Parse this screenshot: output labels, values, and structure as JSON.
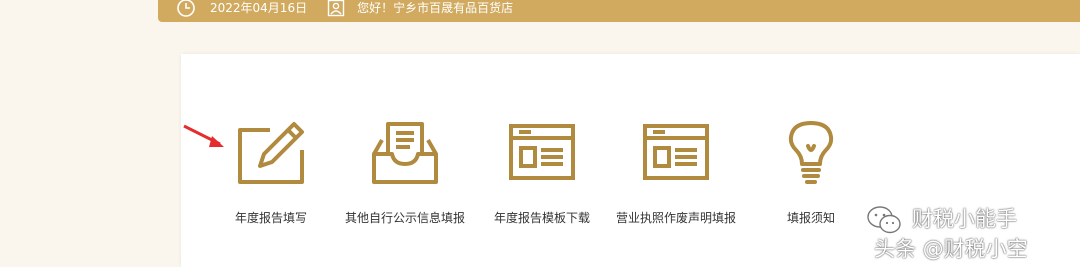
{
  "colors": {
    "accent": "#d1aa5f",
    "icon": "#b08a3e",
    "arrow": "#e52d2d"
  },
  "header": {
    "date": "2022年04月16日",
    "greeting": "您好！宁乡市百晟有品百货店"
  },
  "menu": [
    {
      "label": "年度报告填写",
      "icon": "pencil-edit-icon"
    },
    {
      "label": "其他自行公示信息填报",
      "icon": "inbox-tray-icon"
    },
    {
      "label": "年度报告模板下载",
      "icon": "browser-window-icon"
    },
    {
      "label": "营业执照作废声明填报",
      "icon": "browser-window-icon"
    },
    {
      "label": "填报须知",
      "icon": "lightbulb-icon"
    }
  ],
  "watermark": {
    "line1": "财税小能手",
    "line2": "头条 @财税小空"
  }
}
